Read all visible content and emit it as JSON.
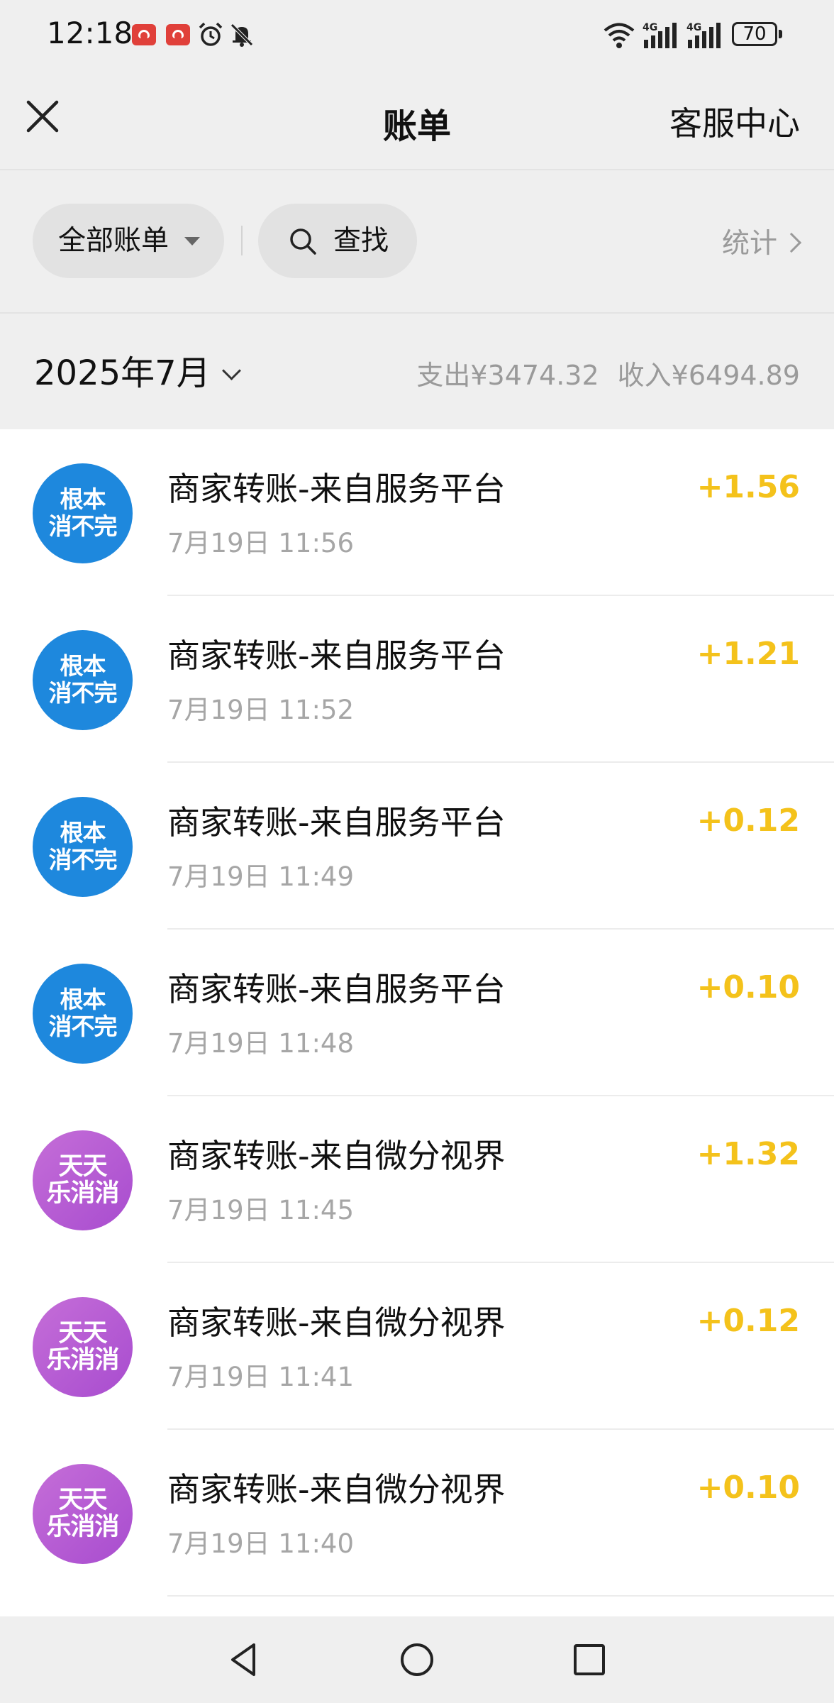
{
  "status_bar": {
    "time": "12:18",
    "battery": "70",
    "network_1": "4G",
    "network_2": "4G",
    "icons": [
      "huawei-app-icon",
      "huawei-app-icon",
      "alarm-icon",
      "bell-off-icon",
      "wifi-icon",
      "signal-icon",
      "signal-icon",
      "battery-icon"
    ]
  },
  "nav": {
    "title": "账单",
    "service": "客服中心",
    "close_icon": "close-icon"
  },
  "filters": {
    "all_bills": "全部账单",
    "search": "查找",
    "stats": "统计"
  },
  "month": {
    "label": "2025年7月",
    "expense": "支出¥3474.32",
    "income": "收入¥6494.89"
  },
  "transactions": [
    {
      "title": "商家转账-来自服务平台",
      "time": "7月19日 11:56",
      "amount": "+1.56",
      "avatar_lines": [
        "根本",
        "消不完"
      ],
      "avatar_style": "blue"
    },
    {
      "title": "商家转账-来自服务平台",
      "time": "7月19日 11:52",
      "amount": "+1.21",
      "avatar_lines": [
        "根本",
        "消不完"
      ],
      "avatar_style": "blue"
    },
    {
      "title": "商家转账-来自服务平台",
      "time": "7月19日 11:49",
      "amount": "+0.12",
      "avatar_lines": [
        "根本",
        "消不完"
      ],
      "avatar_style": "blue"
    },
    {
      "title": "商家转账-来自服务平台",
      "time": "7月19日 11:48",
      "amount": "+0.10",
      "avatar_lines": [
        "根本",
        "消不完"
      ],
      "avatar_style": "blue"
    },
    {
      "title": "商家转账-来自微分视界",
      "time": "7月19日 11:45",
      "amount": "+1.32",
      "avatar_lines": [
        "天天",
        "乐消消"
      ],
      "avatar_style": "purple"
    },
    {
      "title": "商家转账-来自微分视界",
      "time": "7月19日 11:41",
      "amount": "+0.12",
      "avatar_lines": [
        "天天",
        "乐消消"
      ],
      "avatar_style": "purple"
    },
    {
      "title": "商家转账-来自微分视界",
      "time": "7月19日 11:40",
      "amount": "+0.10",
      "avatar_lines": [
        "天天",
        "乐消消"
      ],
      "avatar_style": "purple"
    }
  ],
  "colors": {
    "amount": "#f4c21b",
    "avatar_blue": "#1e88dd",
    "avatar_purple": "#b85bd4",
    "background_gray": "#efefef"
  },
  "system_nav": [
    "back-icon",
    "home-icon",
    "recents-icon"
  ]
}
